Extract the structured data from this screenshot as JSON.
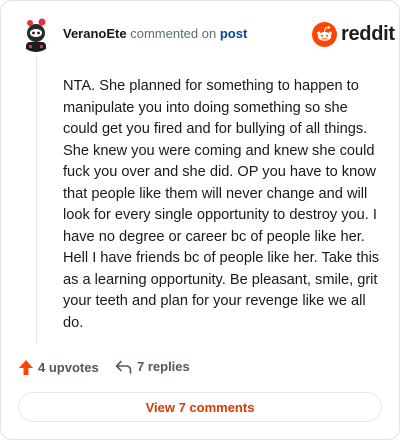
{
  "header": {
    "username": "VeranoEte",
    "action_text": "commented on",
    "post_link": "post",
    "logo_text": "reddit"
  },
  "comment": {
    "body": "NTA. She planned for something to happen to manipulate you into doing something so she could get you fired and for bullying of all things. She knew you were coming and knew she could fuck you over and she did. OP you have to know that people like them will never change and will look for every single opportunity to destroy you. I have no degree or career bc of people like her. Hell I have friends bc of people like her. Take this as a learning opportunity. Be pleasant, smile, grit your teeth and plan for your revenge like we all do."
  },
  "actions": {
    "upvotes": "4 upvotes",
    "replies": "7 replies",
    "view_comments": "View 7 comments"
  },
  "colors": {
    "brand": "#ff4500",
    "link": "#0a449b",
    "button_text": "#d93a00"
  },
  "icons": {
    "upvote": "upvote-arrow-icon",
    "reply": "reply-arrow-icon",
    "logo": "reddit-snoo-icon"
  }
}
